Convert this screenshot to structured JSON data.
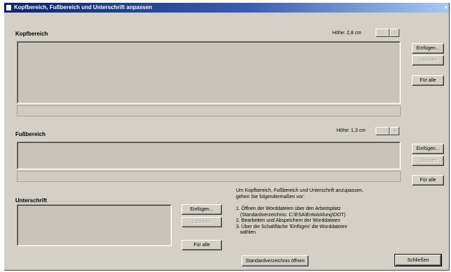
{
  "window": {
    "title": "Kopfbereich, Fußbereich und Unterschrift anpassen",
    "close_glyph": "×"
  },
  "kopfbereich": {
    "label": "Kopfbereich",
    "height_label": "Höhe: 2,8 cm",
    "spin_down": "",
    "spin_up": "-",
    "insert_button": "Einfügen...",
    "delete_button": "Löschen",
    "all_button": "Für alle"
  },
  "fussbereich": {
    "label": "Fußbereich",
    "height_label": "Höhe: 1,3 cm",
    "spin_down": "",
    "spin_up": "-",
    "insert_button": "Einfügen...",
    "delete_button": "Löschen",
    "all_button": "Für alle"
  },
  "unterschrift": {
    "label": "Unterschrift",
    "insert_button": "Einfügen...",
    "delete_button": "Löschen",
    "all_button": "Für alle"
  },
  "instructions": {
    "intro_line1": "Um Kopfbereich, Fußbereich und Unterschrift anzupassen,",
    "intro_line2": "gehen Sie folgendermaßen vor:",
    "step1_line1": "1. Öffnen der Worddateien über den Arbeitsplatz",
    "step1_line2": "(Standardverzeichnis: C:\\ESA\\Entwicklung\\DOT)",
    "step2": "2. Bearbeiten und Abspeichern der Worddateien",
    "step3_line1": "3. Über die Schaltfläche 'Einfügen' die Worddateien",
    "step3_line2": "wählen"
  },
  "footer": {
    "open_dir_button": "Standardverzeichnis öffnen",
    "close_button": "Schließen"
  }
}
